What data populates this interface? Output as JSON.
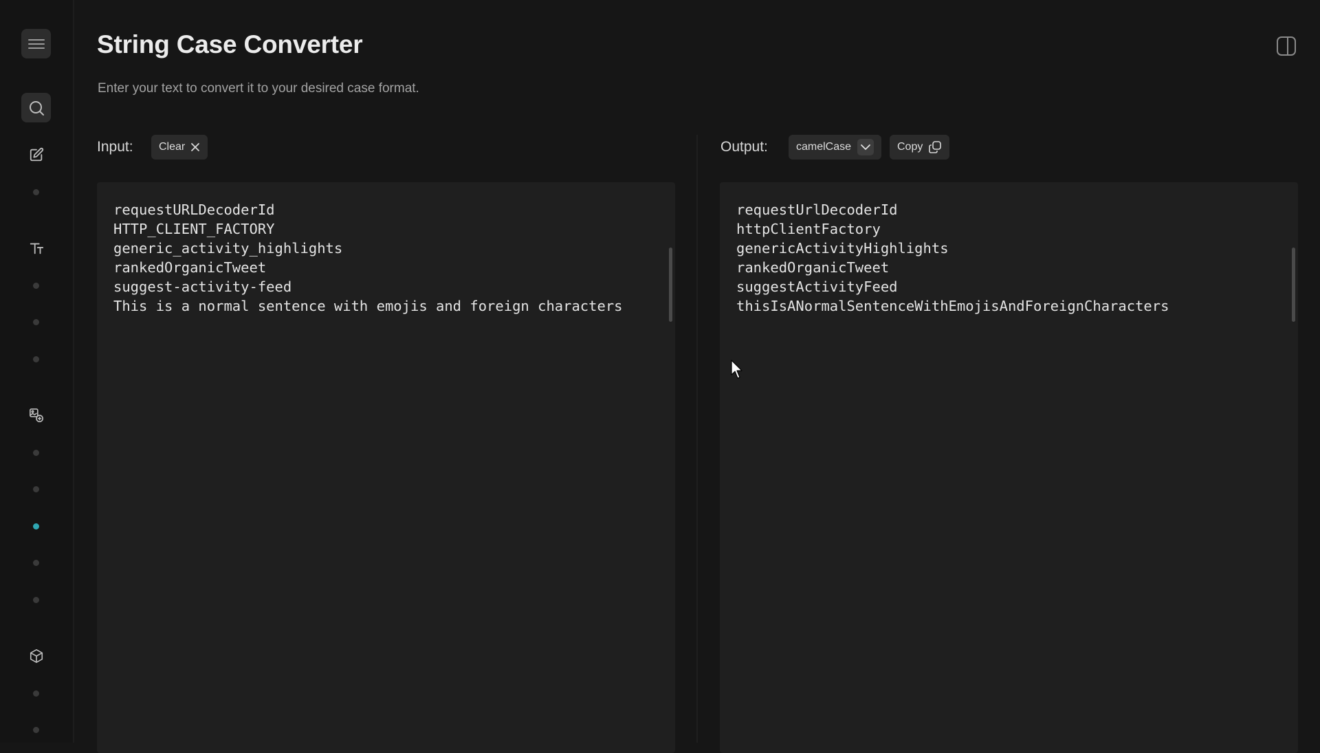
{
  "page": {
    "title": "String Case Converter",
    "subtitle": "Enter your text to convert it to your desired case format."
  },
  "sidebar": {
    "icons": [
      "menu-icon",
      "search-icon",
      "edit-icon",
      "text-icon",
      "image-swap-icon",
      "cube-icon"
    ],
    "active_dot_index": 6,
    "accent_color": "#2fa7b2"
  },
  "input": {
    "label": "Input:",
    "clear_label": "Clear",
    "text": "requestURLDecoderId\nHTTP_CLIENT_FACTORY\ngeneric_activity_highlights\nrankedOrganicTweet\nsuggest-activity-feed\nThis is a normal sentence with emojis and foreign characters"
  },
  "output": {
    "label": "Output:",
    "case_selected": "camelCase",
    "copy_label": "Copy",
    "text": "requestUrlDecoderId\nhttpClientFactory\ngenericActivityHighlights\nrankedOrganicTweet\nsuggestActivityFeed\nthisIsANormalSentenceWithEmojisAndForeignCharacters"
  }
}
